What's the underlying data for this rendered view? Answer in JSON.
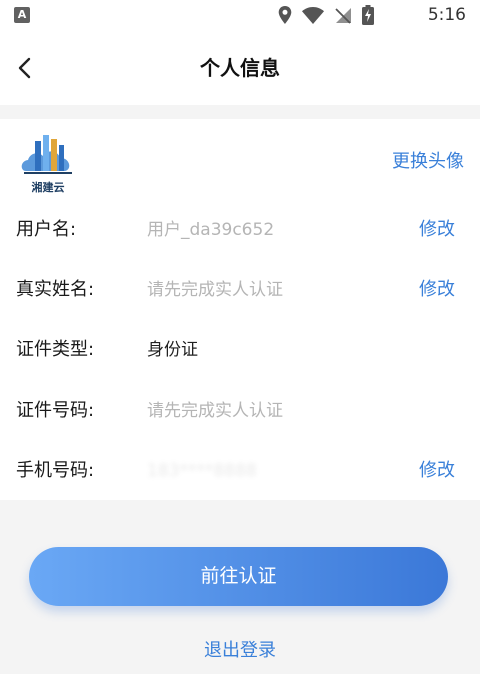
{
  "status_bar": {
    "time": "5:16",
    "icons": [
      "app-a-icon",
      "location-icon",
      "wifi-icon",
      "no-sim-icon",
      "battery-charging-icon"
    ]
  },
  "header": {
    "title": "个人信息"
  },
  "profile": {
    "logo_text": "湘建云",
    "change_avatar": "更换头像"
  },
  "fields": [
    {
      "label": "用户名:",
      "value": "用户_da39c652",
      "action": "修改"
    },
    {
      "label": "真实姓名:",
      "value": "请先完成实人认证",
      "action": "修改"
    },
    {
      "label": "证件类型:",
      "value": "身份证",
      "action": ""
    },
    {
      "label": "证件号码:",
      "value": "请先完成实人认证",
      "action": ""
    },
    {
      "label": "手机号码:",
      "value": "183****8888",
      "action": "修改"
    }
  ],
  "buttons": {
    "primary": "前往认证",
    "logout": "退出登录"
  },
  "colors": {
    "accent": "#3a80d9",
    "button_gradient_start": "#6aa8f5",
    "button_gradient_end": "#3b78d8",
    "background": "#f4f4f4"
  }
}
